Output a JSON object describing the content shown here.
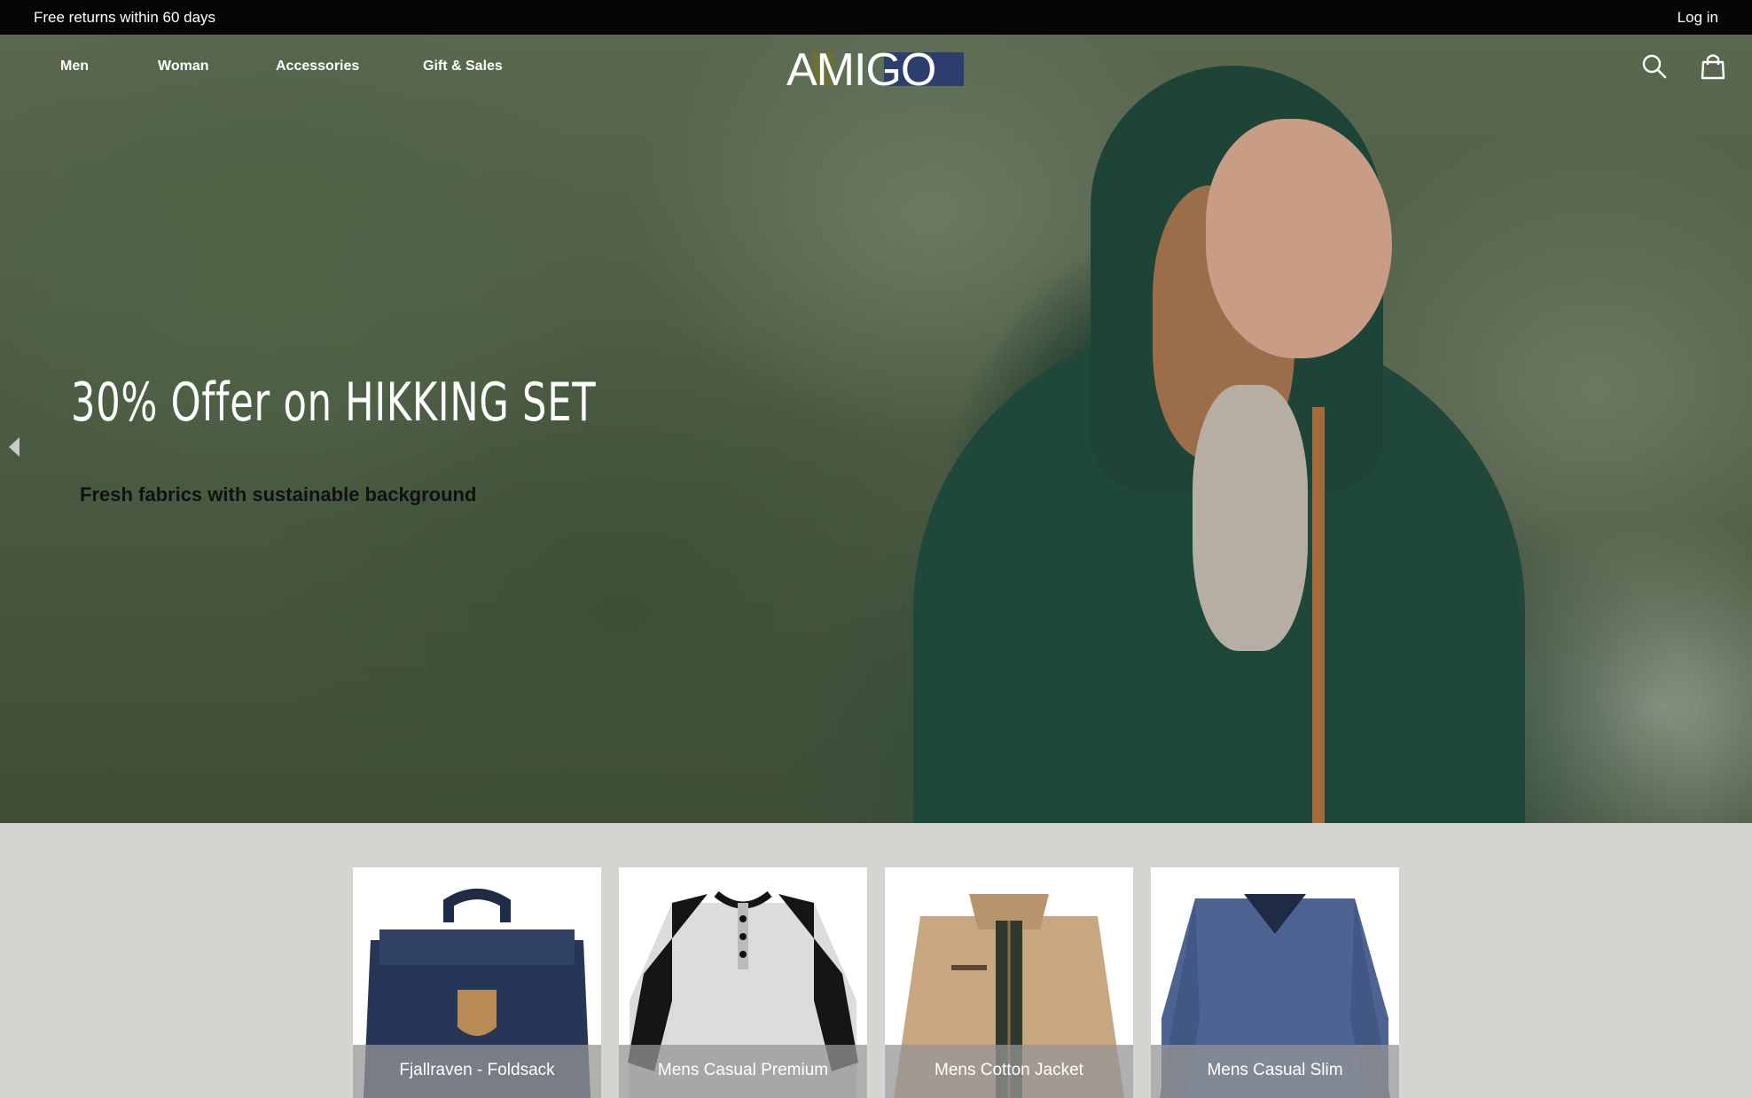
{
  "topbar": {
    "promo": "Free returns within 60 days",
    "login": "Log in"
  },
  "nav": {
    "items": [
      {
        "label": "Men"
      },
      {
        "label": "Woman"
      },
      {
        "label": "Accessories"
      },
      {
        "label": "Gift & Sales"
      }
    ],
    "logo": "AMIGO",
    "icons": [
      "search-icon",
      "shopping-bag-icon"
    ]
  },
  "hero": {
    "title": "30% Offer on HIKKING SET",
    "subtitle": "Fresh fabrics with sustainable background",
    "slides": 3,
    "active_slide": 3
  },
  "products": [
    {
      "name": "Fjallraven - Foldsack"
    },
    {
      "name": "Mens Casual Premium"
    },
    {
      "name": "Mens Cotton Jacket"
    },
    {
      "name": "Mens Casual Slim"
    }
  ],
  "colors": {
    "topbar": "#050505",
    "section_bg": "#d6d4d1",
    "label_overlay": "#969696"
  }
}
